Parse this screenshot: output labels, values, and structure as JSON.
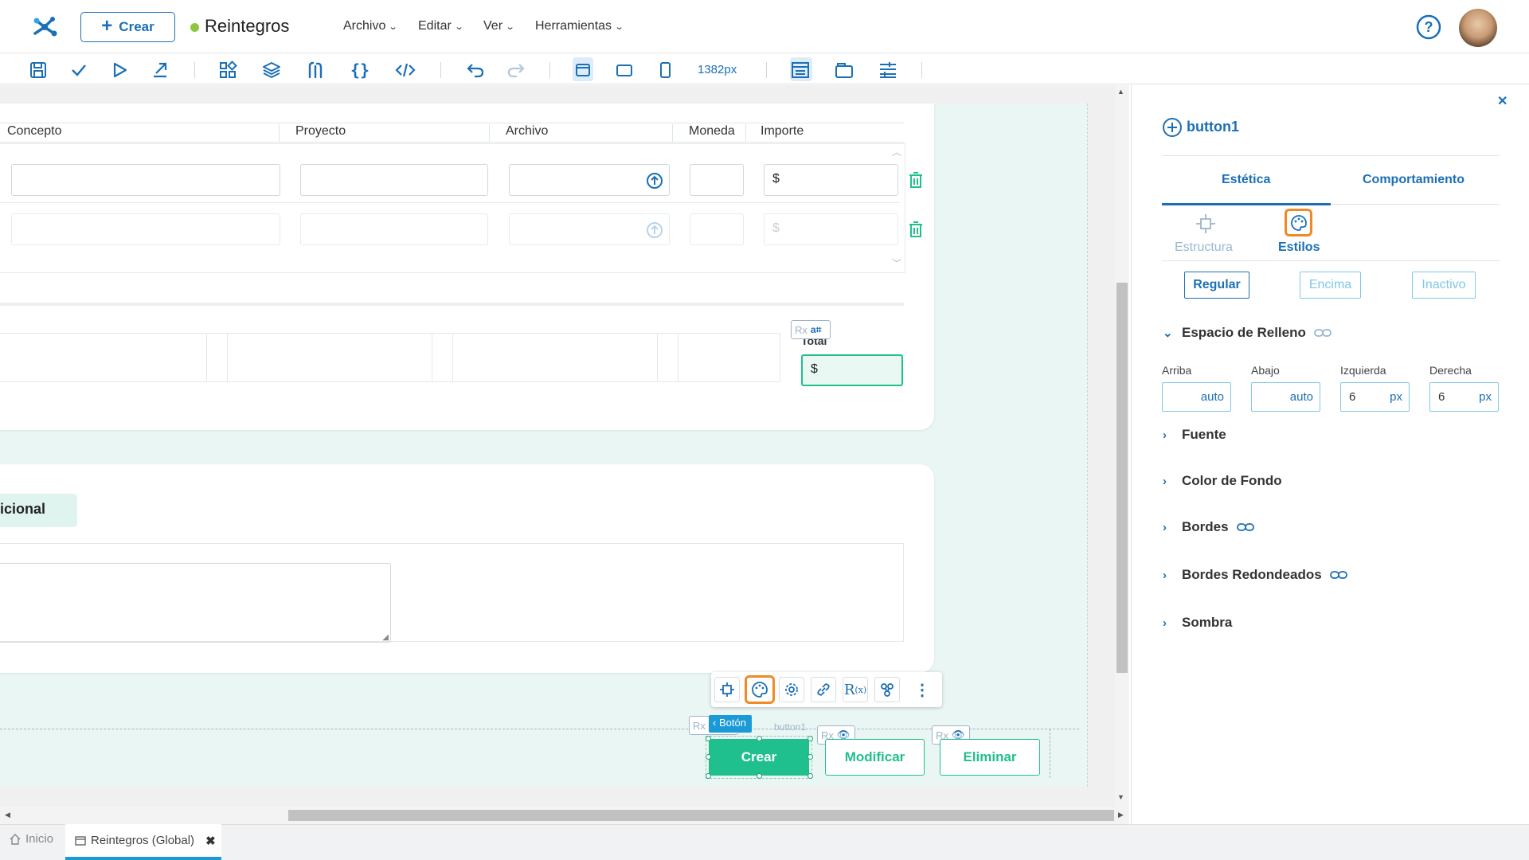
{
  "header": {
    "create_label": "Crear",
    "app_title": "Reintegros",
    "menus": [
      "Archivo",
      "Editar",
      "Ver",
      "Herramientas"
    ],
    "status_color": "#8dc63f",
    "accent": "#1b6fb5"
  },
  "toolbar": {
    "zoom": "1382px",
    "icons": [
      "save-icon",
      "check-icon",
      "play-icon",
      "export-icon",
      "components-icon",
      "layers-icon",
      "variables-icon",
      "braces-icon",
      "code-icon",
      "undo-icon",
      "redo-icon",
      "desktop-view-icon",
      "tablet-view-icon",
      "mobile-view-icon",
      "form-layout-icon",
      "frame-icon",
      "align-icon"
    ]
  },
  "grid": {
    "columns": [
      "Concepto",
      "Proyecto",
      "Archivo",
      "Moneda",
      "Importe"
    ],
    "currency_symbol": "$"
  },
  "totals": {
    "label": "Total",
    "currency_symbol": "$",
    "rx_label": "Rx"
  },
  "section2": {
    "tab_label": "icional"
  },
  "floating_toolbar": {
    "breadcrumb": "Botón",
    "component_name": "button1",
    "rx_label": "Rx"
  },
  "buttons": {
    "create": "Crear",
    "modify": "Modificar",
    "delete": "Eliminar",
    "green": "#20c08e"
  },
  "panel": {
    "title": "button1",
    "tabs": [
      "Estética",
      "Comportamiento"
    ],
    "subtabs": [
      "Estructura",
      "Estilos"
    ],
    "states": [
      "Regular",
      "Encima",
      "Inactivo"
    ],
    "padding_section": "Espacio de Relleno",
    "padding": {
      "labels": [
        "Arriba",
        "Abajo",
        "Izquierda",
        "Derecha"
      ],
      "values": [
        "auto",
        "auto",
        "6",
        "6"
      ],
      "unit": "px"
    },
    "sections": [
      "Fuente",
      "Color de Fondo",
      "Bordes",
      "Bordes Redondeados",
      "Sombra"
    ],
    "active_highlight": "#f08a24"
  },
  "bottom_tabs": {
    "home": "Inicio",
    "current": "Reintegros (Global)"
  }
}
